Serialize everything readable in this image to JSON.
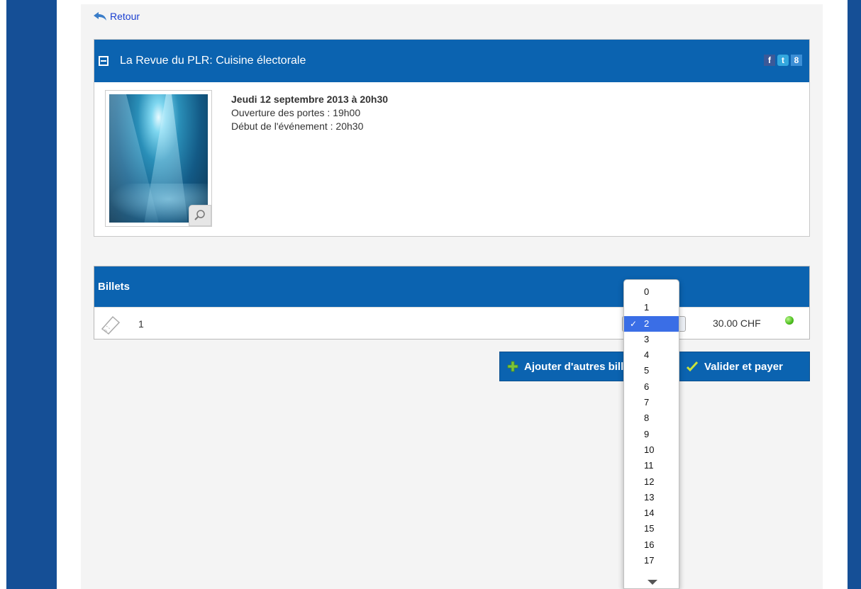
{
  "back": {
    "label": "Retour"
  },
  "event": {
    "title": "La Revue du PLR: Cuisine électorale",
    "date": "Jeudi 12 septembre 2013 à 20h30",
    "doors": "Ouverture des portes : 19h00",
    "start": "Début de l'événement : 20h30",
    "social": {
      "facebook": "f",
      "twitter": "t",
      "google": "8"
    }
  },
  "tickets": {
    "header": "Billets",
    "rows": [
      {
        "name": "1",
        "price": "30.00 CHF",
        "selected_qty": "2",
        "status_color": "#4cbe1d"
      }
    ]
  },
  "actions": {
    "add_label": "Ajouter d'autres billets",
    "pay_label": "Valider et payer"
  },
  "qty_options": [
    "0",
    "1",
    "2",
    "3",
    "4",
    "5",
    "6",
    "7",
    "8",
    "9",
    "10",
    "11",
    "12",
    "13",
    "14",
    "15",
    "16",
    "17"
  ],
  "colors": {
    "brand_blue": "#0b63b0",
    "side_blue": "#154f96",
    "link": "#1a3fd1",
    "selected": "#3a6ee6"
  }
}
